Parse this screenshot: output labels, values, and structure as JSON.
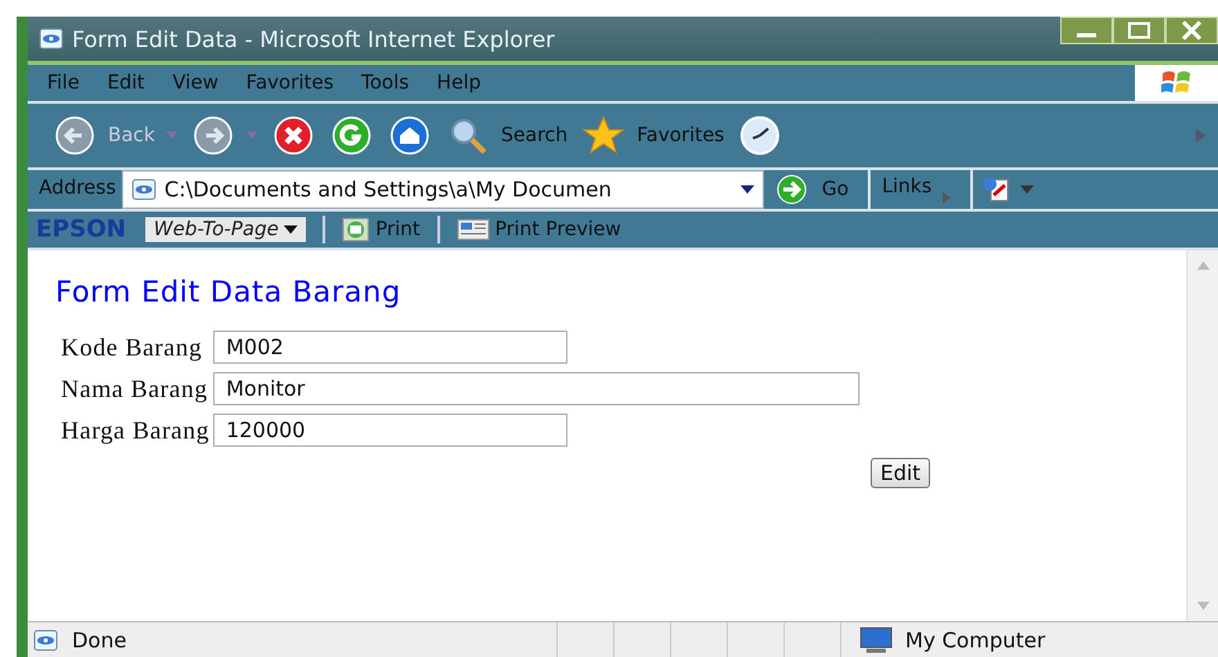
{
  "window": {
    "title": "Form Edit Data - Microsoft Internet Explorer"
  },
  "menu": [
    "File",
    "Edit",
    "View",
    "Favorites",
    "Tools",
    "Help"
  ],
  "toolbar": [
    {
      "kind": "back",
      "label": "Back"
    },
    {
      "kind": "forward"
    },
    {
      "kind": "stop"
    },
    {
      "kind": "refresh"
    },
    {
      "kind": "home"
    },
    {
      "kind": "search",
      "label": "Search"
    },
    {
      "kind": "favorites",
      "label": "Favorites"
    },
    {
      "kind": "history"
    }
  ],
  "address": {
    "label": "Address",
    "value": "C:\\Documents and Settings\\a\\My Documen",
    "go": "Go",
    "links": "Links"
  },
  "epson": {
    "brand": "EPSON",
    "dropdown": "Web-To-Page",
    "print": "Print",
    "preview": "Print Preview"
  },
  "page": {
    "heading": "Form Edit Data Barang",
    "fields": [
      {
        "label": "Kode Barang",
        "value": "M002",
        "kind": "short"
      },
      {
        "label": "Nama Barang",
        "value": "Monitor",
        "kind": "long"
      },
      {
        "label": "Harga Barang",
        "value": "120000",
        "kind": "short"
      }
    ],
    "button": "Edit"
  },
  "status_bar": {
    "text": "Done",
    "zone": "My Computer"
  }
}
